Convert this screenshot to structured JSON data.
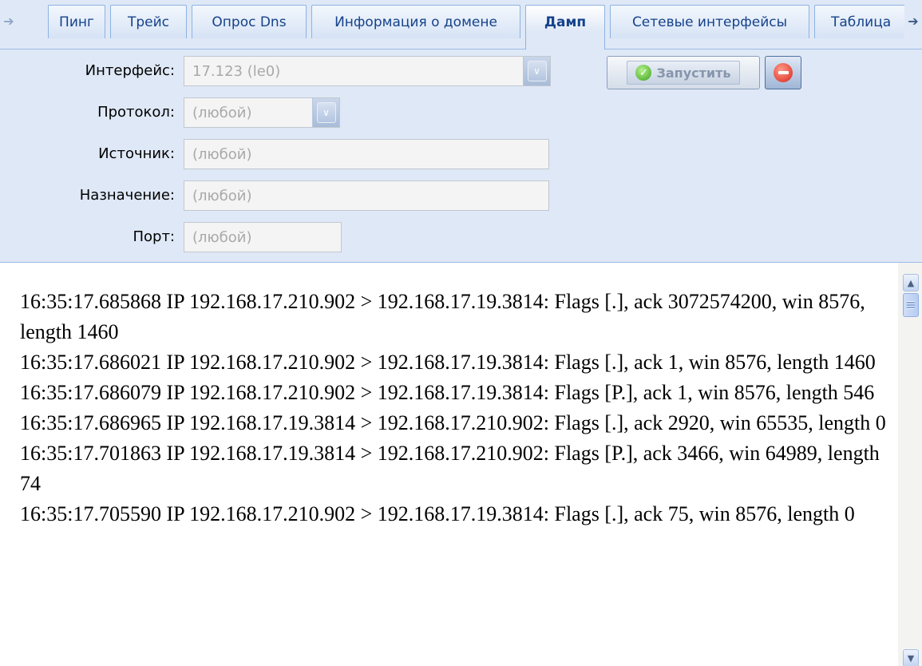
{
  "tabs": [
    {
      "label": "Пинг",
      "active": false
    },
    {
      "label": "Трейс",
      "active": false
    },
    {
      "label": "Опрос Dns",
      "active": false
    },
    {
      "label": "Информация о домене",
      "active": false
    },
    {
      "label": "Дамп",
      "active": true
    },
    {
      "label": "Сетевые интерфейсы",
      "active": false
    },
    {
      "label": "Таблица",
      "active": false
    }
  ],
  "form": {
    "interface_label": "Интерфейс:",
    "interface_value": "17.123 (le0)",
    "protocol_label": "Протокол:",
    "protocol_value": "(любой)",
    "source_label": "Источник:",
    "source_placeholder": "(любой)",
    "destination_label": "Назначение:",
    "destination_placeholder": "(любой)",
    "port_label": "Порт:",
    "port_placeholder": "(любой)"
  },
  "actions": {
    "run_label": "Запустить"
  },
  "output": {
    "lines": [
      "16:35:17.685868 IP 192.168.17.210.902 > 192.168.17.19.3814: Flags [.], ack 3072574200, win 8576, length 1460",
      "16:35:17.686021 IP 192.168.17.210.902 > 192.168.17.19.3814: Flags [.], ack 1, win 8576, length 1460",
      "16:35:17.686079 IP 192.168.17.210.902 > 192.168.17.19.3814: Flags [P.], ack 1, win 8576, length 546",
      "16:35:17.686965 IP 192.168.17.19.3814 > 192.168.17.210.902: Flags [.], ack 2920, win 65535, length 0",
      "16:35:17.701863 IP 192.168.17.19.3814 > 192.168.17.210.902: Flags [P.], ack 3466, win 64989, length 74",
      "16:35:17.705590 IP 192.168.17.210.902 > 192.168.17.19.3814: Flags [.], ack 75, win 8576, length 0"
    ]
  }
}
